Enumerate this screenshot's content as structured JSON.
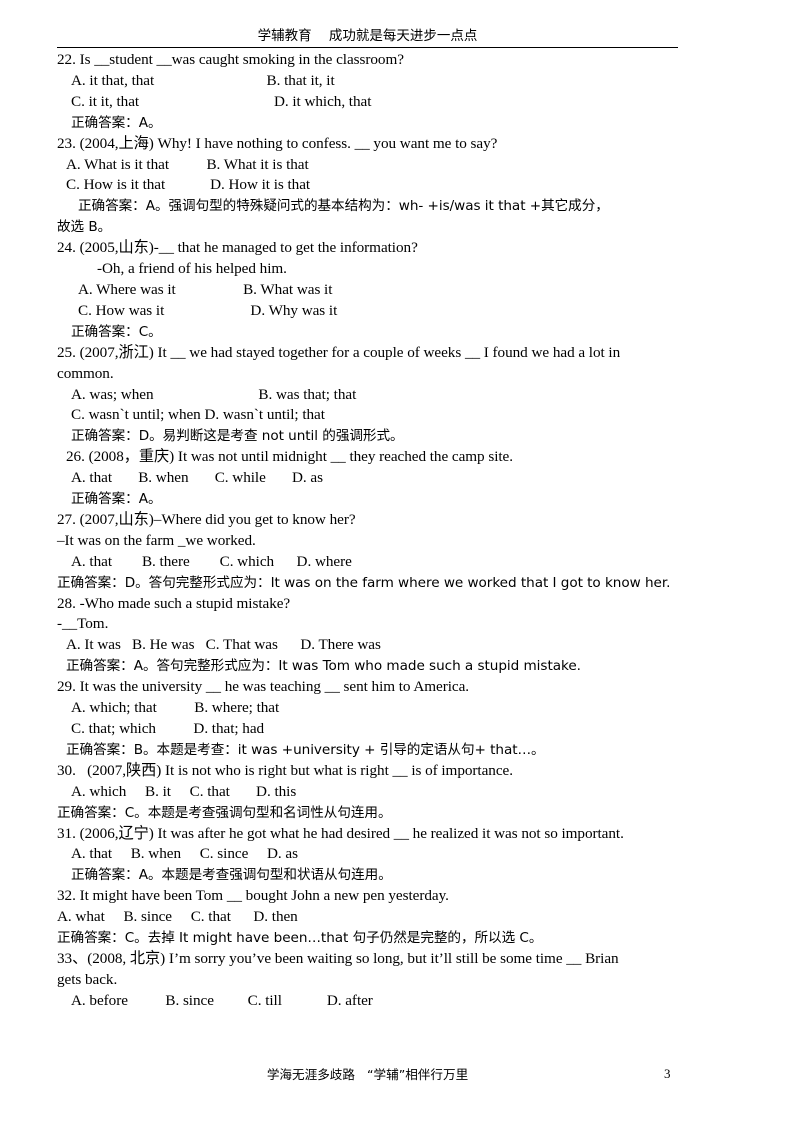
{
  "header": {
    "text": "学辅教育    成功就是每天进步一点点"
  },
  "footer": {
    "text": "学海无涯多歧路   “学辅”相伴行万里",
    "page_number": "3"
  },
  "questions": [
    {
      "id": "q22",
      "stem": "22. Is __student __was caught smoking in the classroom?",
      "options_line1": "A. it that, that                              B. that it, it",
      "options_line2": "C. it it, that                                    D. it which, that",
      "answer": "正确答案：A。"
    },
    {
      "id": "q23",
      "stem": "23. (2004,上海) Why! I have nothing to confess. __ you want me to say?",
      "options_line1": "A. What is it that          B. What it is that",
      "options_line2": "C. How is it that            D. How it is that",
      "answer_a": "正确答案：A。强调句型的特殊疑问式的基本结构为：wh- +is/was it that +其它成分，",
      "answer_b": "故选 B。"
    },
    {
      "id": "q24",
      "stem": "24. (2005,山东)-__ that he managed to get the information?",
      "reply": "-Oh, a friend of his helped him.",
      "options_line1": "A. Where was it                  B. What was it",
      "options_line2": "C. How was it                       D. Why was it",
      "answer": "正确答案：C。"
    },
    {
      "id": "q25",
      "stem_a": "25. (2007,浙江) It __ we had stayed together for a couple of weeks __ I found we had a lot in",
      "stem_b": "common.",
      "options_line1": "A. was; when                            B. was that; that",
      "options_line2": "C. wasn`t until; when D. wasn`t until; that",
      "answer": "正确答案：D。易判断这是考查 not until 的强调形式。"
    },
    {
      "id": "q26",
      "stem": "26. (2008，重庆) It was not until midnight __ they reached the camp site.",
      "options_line1": "A. that       B. when       C. while       D. as",
      "answer": "正确答案：A。"
    },
    {
      "id": "q27",
      "stem": "27. (2007,山东)–Where did you get to know her?",
      "reply": "–It was on the farm _we worked.",
      "options_line1": "A. that        B. there        C. which      D. where",
      "answer": "正确答案：D。答句完整形式应为：It was on the farm where we worked that I got to know her."
    },
    {
      "id": "q28",
      "stem": "28. -Who made such a stupid mistake?",
      "reply": "-__Tom.",
      "options_line1": "A. It was   B. He was   C. That was      D. There was",
      "answer": "正确答案：A。答句完整形式应为：It was Tom who made such a stupid mistake."
    },
    {
      "id": "q29",
      "stem": "29. It was the university __ he was teaching __ sent him to America.",
      "options_line1": "A. which; that          B. where; that",
      "options_line2": "C. that; which          D. that; had",
      "answer": "正确答案：B。本题是考查：it was +university + 引导的定语从句+ that…。"
    },
    {
      "id": "q30",
      "stem": "30.   (2007,陕西) It is not who is right but what is right __ is of importance.",
      "options_line1": "A. which     B. it     C. that       D. this",
      "answer": "正确答案：C。本题是考查强调句型和名词性从句连用。"
    },
    {
      "id": "q31",
      "stem": "31. (2006,辽宁) It was after he got what he had desired __ he realized it was not so important.",
      "options_line1": "A. that     B. when     C. since     D. as",
      "answer": "正确答案：A。本题是考查强调句型和状语从句连用。"
    },
    {
      "id": "q32",
      "stem": "32. It might have been Tom __ bought John a new pen yesterday.",
      "options_line1": "A. what     B. since     C. that      D. then",
      "answer": "正确答案：C。去掉 It might have been…that 句子仍然是完整的，所以选 C。"
    },
    {
      "id": "q33",
      "stem_a": "33、(2008, 北京) I’m sorry you’ve been waiting so long, but it’ll still be some time __ Brian",
      "stem_b": "gets back.",
      "options_line1": "A. before          B. since         C. till            D. after"
    }
  ]
}
